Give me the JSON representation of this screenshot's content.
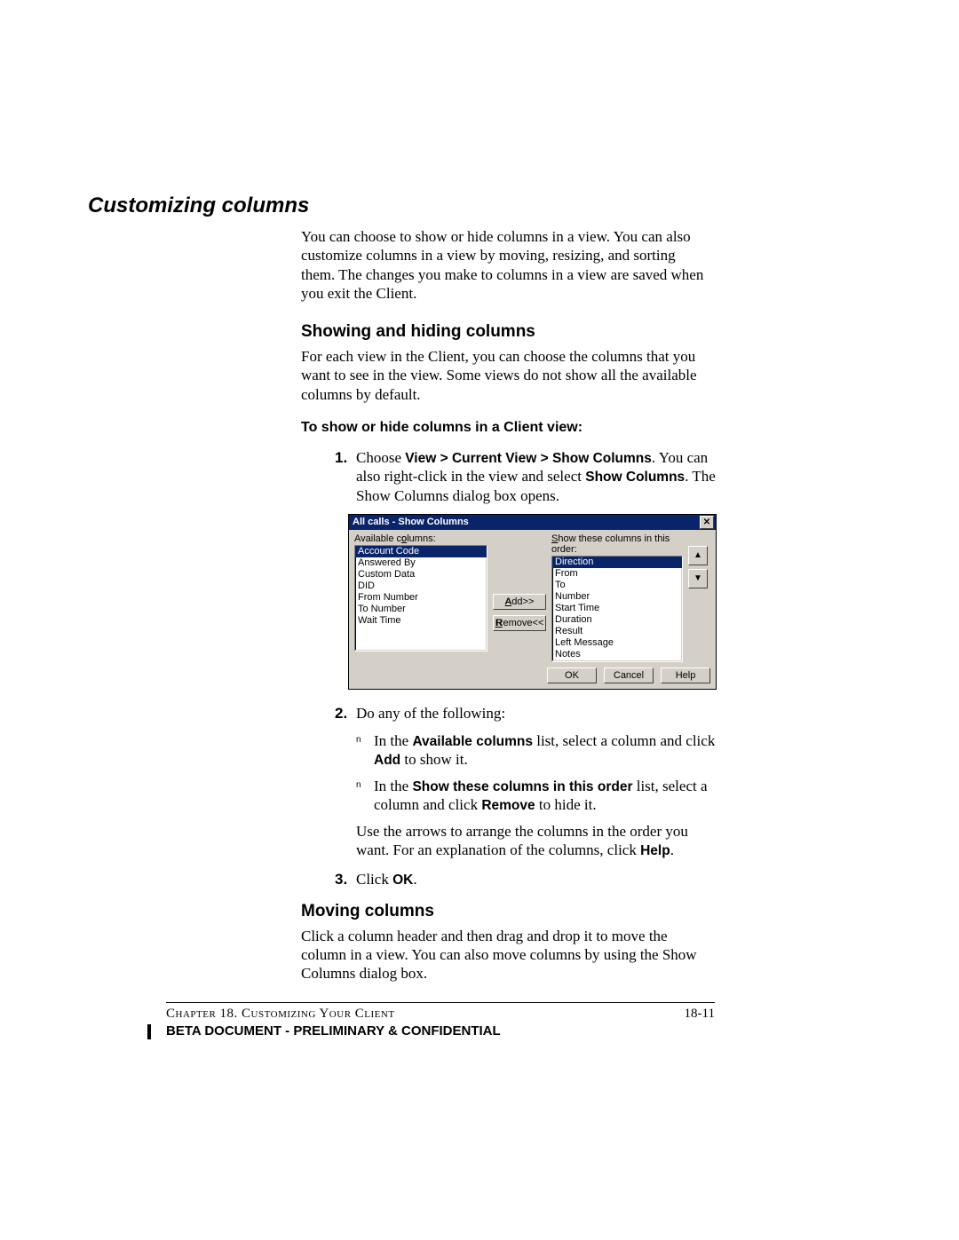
{
  "h1": "Customizing columns",
  "intro": "You can choose to show or hide columns in a view. You can also customize columns in a view by moving, resizing, and sorting them. The changes you make to columns in a view are saved when you exit the Client.",
  "h2a": "Showing and hiding columns",
  "p1": "For each view in the Client, you can choose the columns that you want to see in the view. Some views do not show all the available columns by default.",
  "h3a": "To show or hide columns in a Client view:",
  "step1_pre": "Choose ",
  "step1_b1": "View > Current View > Show Columns",
  "step1_mid": ". You can also right-click in the view and select ",
  "step1_b2": "Show Columns",
  "step1_post": ". The Show Columns dialog box opens.",
  "dialog": {
    "title": "All calls - Show Columns",
    "avail_label_pre": "Available c",
    "avail_label_post": "olumns:",
    "show_label_pre": "S",
    "show_label_post": "how these columns in this order:",
    "available": [
      "Account Code",
      "Answered By",
      "Custom Data",
      "DID",
      "From Number",
      "To Number",
      "Wait Time"
    ],
    "shown": [
      "Direction",
      "From",
      "To",
      "Number",
      "Start Time",
      "Duration",
      "Result",
      "Left Message",
      "Notes"
    ],
    "add": "Add>>",
    "remove": "Remove<<",
    "ok": "OK",
    "cancel": "Cancel",
    "help": "Help"
  },
  "step2_text": "Do any of the following:",
  "sub1_pre": "In the ",
  "sub1_b1": "Available columns",
  "sub1_mid": " list, select a column and click ",
  "sub1_b2": "Add",
  "sub1_post": " to show it.",
  "sub2_pre": "In the ",
  "sub2_b1": "Show these columns in this order",
  "sub2_mid": " list, select a column and click ",
  "sub2_b2": "Remove",
  "sub2_post": " to hide it.",
  "after_sub_pre": "Use the arrows to arrange the columns in the order you want. For an explanation of the columns, click ",
  "after_sub_b": "Help",
  "step3_pre": "Click ",
  "step3_b": "OK",
  "h2b": "Moving columns",
  "p2": "Click a column header and then drag and drop it to move the column in a view. You can also move columns by using the Show Columns dialog box.",
  "footer_chapter_pre": "Chapter 18. Customizing Your Client",
  "footer_page": "18-11",
  "footer_beta": "BETA DOCUMENT - PRELIMINARY & CONFIDENTIAL",
  "num1": "1.",
  "num2": "2.",
  "num3": "3.",
  "period": ".",
  "n_mark": "n"
}
